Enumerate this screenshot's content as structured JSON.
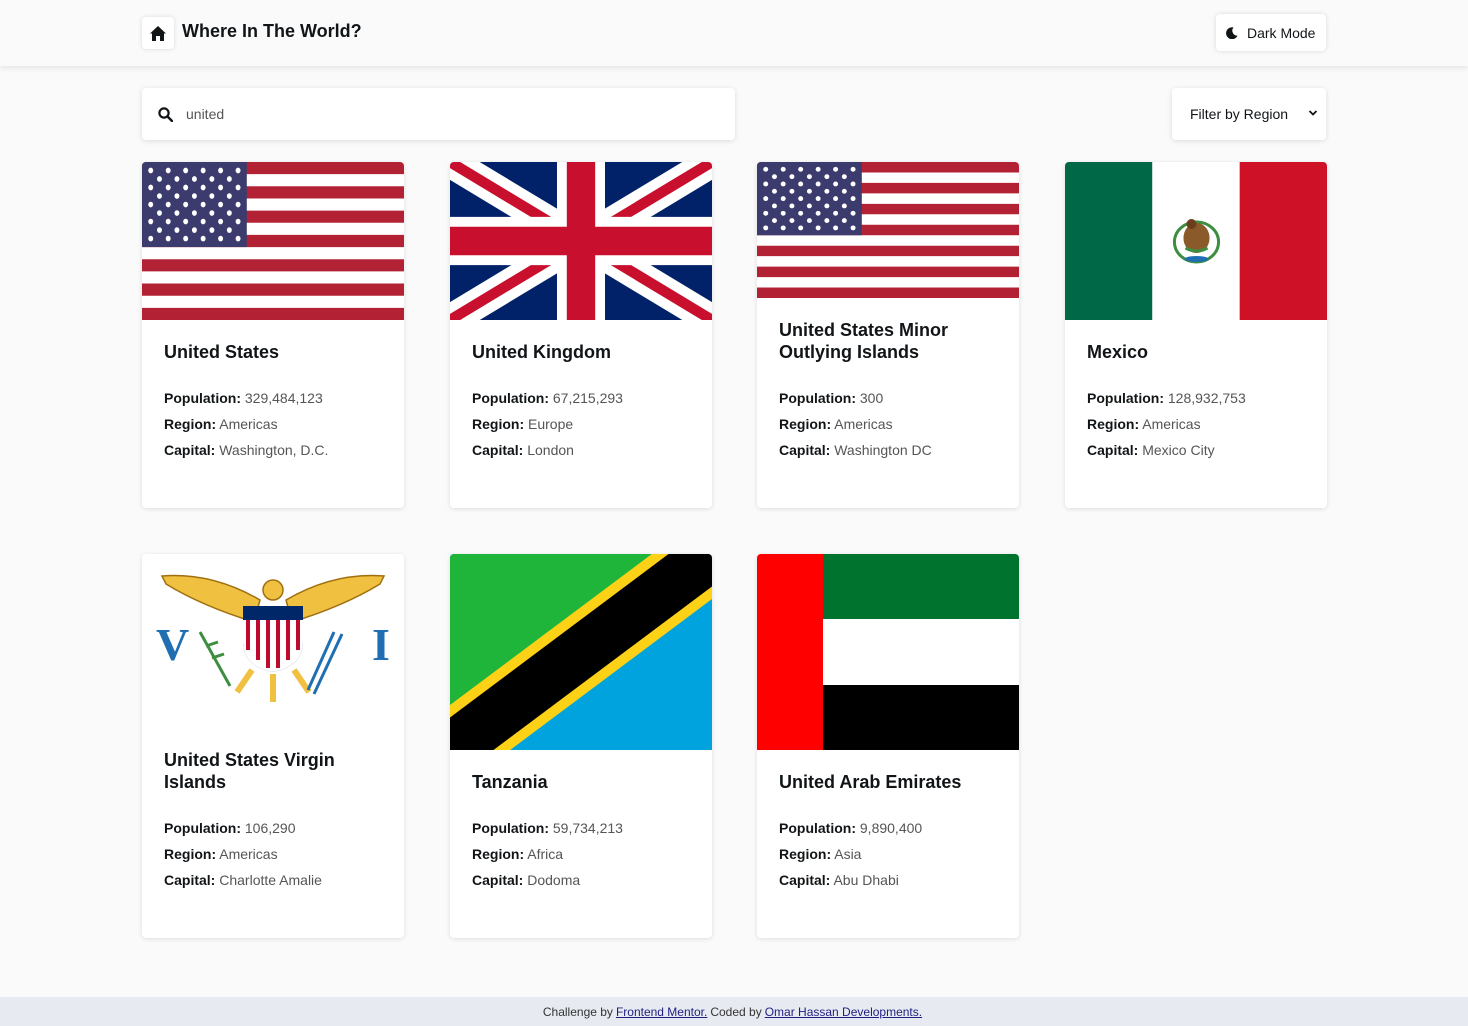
{
  "header": {
    "title": "Where In The World?",
    "dark_mode_label": "Dark Mode"
  },
  "search": {
    "value": "united"
  },
  "filter": {
    "selected": "Filter by Region"
  },
  "labels": {
    "population": "Population:",
    "region": "Region:",
    "capital": "Capital:"
  },
  "countries": [
    {
      "name": "United States",
      "population": "329,484,123",
      "region": "Americas",
      "capital": "Washington, D.C.",
      "flag": "usa"
    },
    {
      "name": "United Kingdom",
      "population": "67,215,293",
      "region": "Europe",
      "capital": "London",
      "flag": "uk"
    },
    {
      "name": "United States Minor Outlying Islands",
      "population": "300",
      "region": "Americas",
      "capital": "Washington DC",
      "flag": "usa"
    },
    {
      "name": "Mexico",
      "population": "128,932,753",
      "region": "Americas",
      "capital": "Mexico City",
      "flag": "mexico"
    },
    {
      "name": "United States Virgin Islands",
      "population": "106,290",
      "region": "Americas",
      "capital": "Charlotte Amalie",
      "flag": "usvi"
    },
    {
      "name": "Tanzania",
      "population": "59,734,213",
      "region": "Africa",
      "capital": "Dodoma",
      "flag": "tanzania"
    },
    {
      "name": "United Arab Emirates",
      "population": "9,890,400",
      "region": "Asia",
      "capital": "Abu Dhabi",
      "flag": "uae"
    }
  ],
  "footer": {
    "prefix": "Challenge by",
    "link1": "Frontend Mentor.",
    "middle": "Coded by",
    "link2": "Omar Hassan Developments."
  },
  "colors": {
    "background": "#fafafa",
    "card": "#ffffff",
    "text": "#111517",
    "footer_bg": "#e7ebf1"
  }
}
